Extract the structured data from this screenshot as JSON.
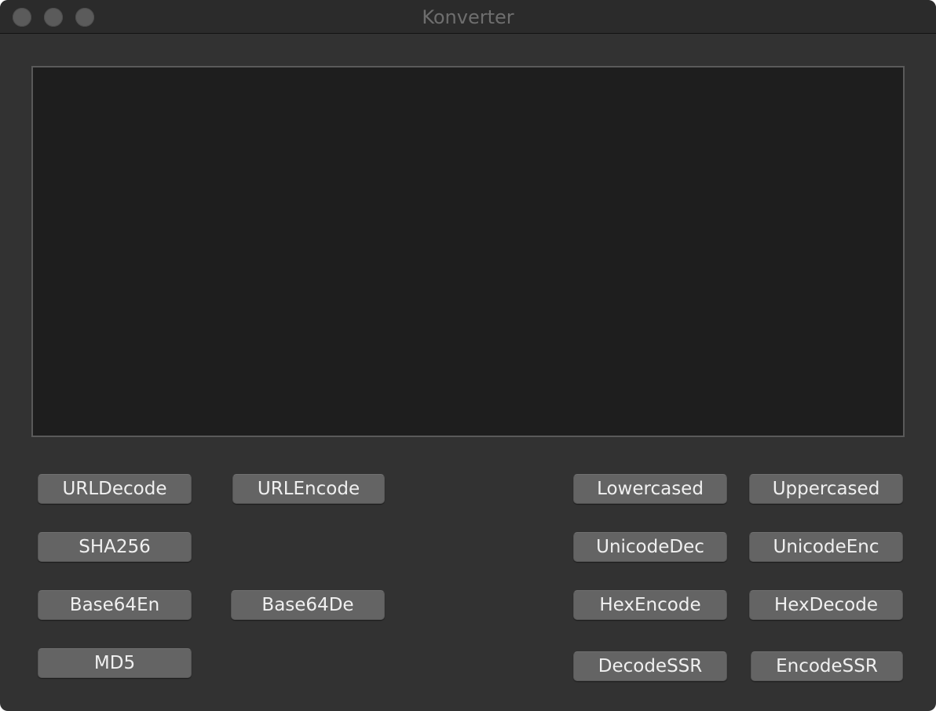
{
  "window": {
    "title": "Konverter"
  },
  "editor": {
    "value": ""
  },
  "buttons": {
    "url_decode": "URLDecode",
    "url_encode": "URLEncode",
    "sha256": "SHA256",
    "base64_en": "Base64En",
    "base64_de": "Base64De",
    "md5": "MD5",
    "lowercased": "Lowercased",
    "uppercased": "Uppercased",
    "unicode_dec": "UnicodeDec",
    "unicode_enc": "UnicodeEnc",
    "hex_encode": "HexEncode",
    "hex_decode": "HexDecode",
    "decode_ssr": "DecodeSSR",
    "encode_ssr": "EncodeSSR"
  }
}
